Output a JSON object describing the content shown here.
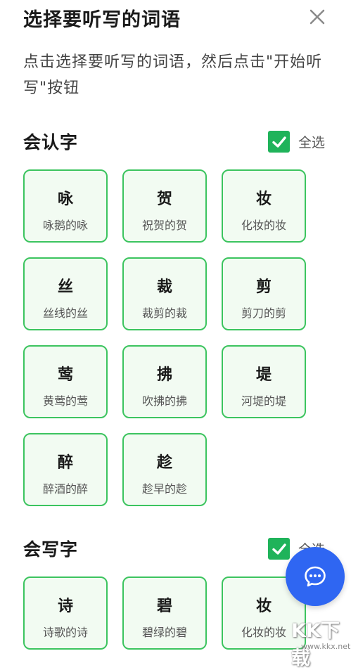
{
  "header": {
    "title": "选择要听写的词语"
  },
  "instruction": "点击选择要听写的词语，然后点击\"开始听写\"按钮",
  "sections": [
    {
      "title": "会认字",
      "select_all_label": "全选",
      "cards": [
        {
          "char": "咏",
          "word": "咏鹅的咏"
        },
        {
          "char": "贺",
          "word": "祝贺的贺"
        },
        {
          "char": "妆",
          "word": "化妆的妆"
        },
        {
          "char": "丝",
          "word": "丝线的丝"
        },
        {
          "char": "裁",
          "word": "裁剪的裁"
        },
        {
          "char": "剪",
          "word": "剪刀的剪"
        },
        {
          "char": "莺",
          "word": "黄莺的莺"
        },
        {
          "char": "拂",
          "word": "吹拂的拂"
        },
        {
          "char": "堤",
          "word": "河堤的堤"
        },
        {
          "char": "醉",
          "word": "醉酒的醉"
        },
        {
          "char": "趁",
          "word": "趁早的趁"
        }
      ]
    },
    {
      "title": "会写字",
      "select_all_label": "全选",
      "cards": [
        {
          "char": "诗",
          "word": "诗歌的诗"
        },
        {
          "char": "碧",
          "word": "碧绿的碧"
        },
        {
          "char": "妆",
          "word": "化妆的妆"
        }
      ]
    }
  ],
  "watermark": {
    "logo": "KK下载",
    "url": "www.kkx.net"
  },
  "colors": {
    "accent": "#3cc45f",
    "check": "#1fb35a",
    "fab": "#2f66f2",
    "card_bg": "#f2fbf2"
  },
  "icons": {
    "close": "close-icon",
    "check": "check-icon",
    "chat": "chat-icon"
  }
}
